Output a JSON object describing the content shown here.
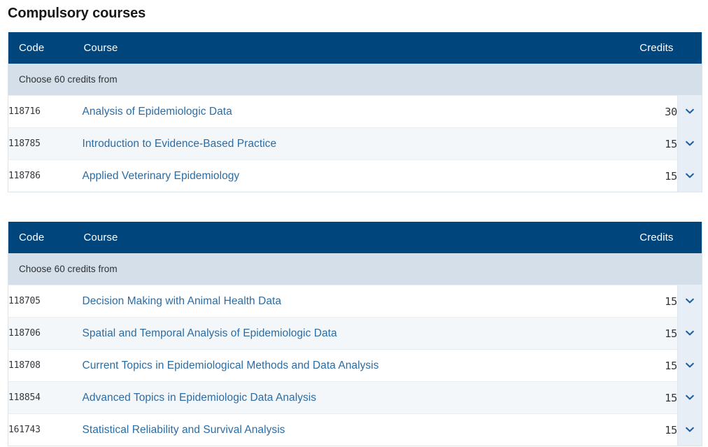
{
  "page": {
    "heading": "Compulsory courses",
    "colors": {
      "header_blue": "#00457c",
      "group_band": "#d5dfe9",
      "row_alt": "#f3f7fa",
      "toggle_cell": "#e7eef6",
      "link_blue": "#2b6ca3",
      "chevron": "#1f5fa0"
    }
  },
  "tables": [
    {
      "columns": {
        "code": "Code",
        "course": "Course",
        "credits": "Credits",
        "toggle": ""
      },
      "group_label": "Choose 60 credits from",
      "rows": [
        {
          "code": "118716",
          "course": "Analysis of Epidemiologic Data",
          "credits": "30",
          "toggle_icon": "chevron-down-icon"
        },
        {
          "code": "118785",
          "course": "Introduction to Evidence-Based Practice",
          "credits": "15",
          "toggle_icon": "chevron-down-icon"
        },
        {
          "code": "118786",
          "course": "Applied Veterinary Epidemiology",
          "credits": "15",
          "toggle_icon": "chevron-down-icon"
        }
      ]
    },
    {
      "columns": {
        "code": "Code",
        "course": "Course",
        "credits": "Credits",
        "toggle": ""
      },
      "group_label": "Choose 60 credits from",
      "rows": [
        {
          "code": "118705",
          "course": "Decision Making with Animal Health Data",
          "credits": "15",
          "toggle_icon": "chevron-down-icon"
        },
        {
          "code": "118706",
          "course": "Spatial and Temporal Analysis of Epidemiologic Data",
          "credits": "15",
          "toggle_icon": "chevron-down-icon"
        },
        {
          "code": "118708",
          "course": "Current Topics in Epidemiological Methods and Data Analysis",
          "credits": "15",
          "toggle_icon": "chevron-down-icon"
        },
        {
          "code": "118854",
          "course": "Advanced Topics in Epidemiologic Data Analysis",
          "credits": "15",
          "toggle_icon": "chevron-down-icon"
        },
        {
          "code": "161743",
          "course": "Statistical Reliability and Survival Analysis",
          "credits": "15",
          "toggle_icon": "chevron-down-icon"
        }
      ]
    }
  ]
}
